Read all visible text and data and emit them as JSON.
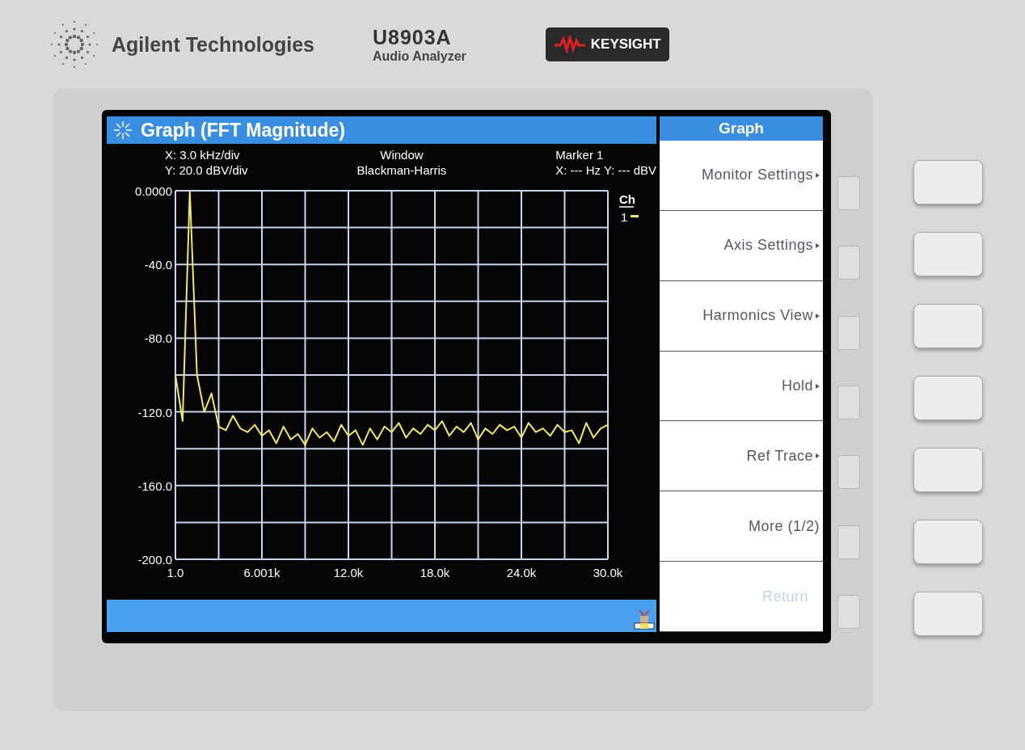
{
  "device": {
    "brand": "Agilent Technologies",
    "model": "U8903A",
    "subtitle": "Audio Analyzer",
    "badge": "KEYSIGHT"
  },
  "screen": {
    "title": "Graph (FFT Magnitude)",
    "info": [
      {
        "lines": [
          "X: 3.0 kHz/div",
          "Y: 20.0 dBV/div"
        ]
      },
      {
        "lines": [
          "Window",
          "Blackman-Harris"
        ]
      },
      {
        "lines": [
          "Marker 1",
          "X: --- Hz Y: --- dBV"
        ]
      }
    ],
    "legend": {
      "heading": "Ch"
    },
    "chart_data": {
      "type": "line",
      "x": [
        1,
        500,
        1000,
        1500,
        2000,
        2500,
        3000,
        3500,
        4000,
        4500,
        5000,
        5500,
        6000,
        6500,
        7000,
        7500,
        8000,
        8500,
        9000,
        9500,
        10000,
        10500,
        11000,
        11500,
        12000,
        12500,
        13000,
        13500,
        14000,
        14500,
        15000,
        15500,
        16000,
        16500,
        17000,
        17500,
        18000,
        18500,
        19000,
        19500,
        20000,
        20500,
        21000,
        21500,
        22000,
        22500,
        23000,
        23500,
        24000,
        24500,
        25000,
        25500,
        26000,
        26500,
        27000,
        27500,
        28000,
        28500,
        29000,
        29500,
        30000
      ],
      "grid": true,
      "series": [
        {
          "name": "1",
          "color": "#f2e86a",
          "values": [
            -100,
            -125,
            0,
            -100,
            -120,
            -110,
            -128,
            -130,
            -122,
            -129,
            -131,
            -127,
            -133,
            -130,
            -137,
            -128,
            -135,
            -132,
            -138,
            -129,
            -134,
            -131,
            -136,
            -127,
            -133,
            -130,
            -138,
            -129,
            -135,
            -128,
            -131,
            -126,
            -134,
            -129,
            -132,
            -127,
            -130,
            -125,
            -133,
            -128,
            -131,
            -126,
            -135,
            -129,
            -132,
            -127,
            -130,
            -128,
            -134,
            -126,
            -131,
            -129,
            -133,
            -127,
            -131,
            -130,
            -137,
            -126,
            -134,
            -129,
            -127
          ]
        }
      ],
      "xlim": [
        1,
        30000
      ],
      "ylim": [
        -200,
        0
      ],
      "xticks": [
        {
          "value": 1,
          "label": "1.0"
        },
        {
          "value": 6001,
          "label": "6.001k"
        },
        {
          "value": 12000,
          "label": "12.0k"
        },
        {
          "value": 18000,
          "label": "18.0k"
        },
        {
          "value": 24000,
          "label": "24.0k"
        },
        {
          "value": 30000,
          "label": "30.0k"
        }
      ],
      "yticks": [
        {
          "value": 0,
          "label": "0.0000"
        },
        {
          "value": -40,
          "label": "-40.0"
        },
        {
          "value": -80,
          "label": "-80.0"
        },
        {
          "value": -120,
          "label": "-120.0"
        },
        {
          "value": -160,
          "label": "-160.0"
        },
        {
          "value": -200,
          "label": "-200.0"
        }
      ]
    }
  },
  "menu": {
    "title": "Graph",
    "items": [
      {
        "label": "Monitor Settings",
        "submenu": true,
        "disabled": false
      },
      {
        "label": "Axis Settings",
        "submenu": true,
        "disabled": false
      },
      {
        "label": "Harmonics View",
        "submenu": true,
        "disabled": false
      },
      {
        "label": "Hold",
        "submenu": true,
        "disabled": false
      },
      {
        "label": "Ref Trace",
        "submenu": true,
        "disabled": false
      },
      {
        "label": "More (1/2)",
        "submenu": false,
        "disabled": false
      },
      {
        "label": "Return",
        "submenu": false,
        "disabled": true
      }
    ]
  }
}
